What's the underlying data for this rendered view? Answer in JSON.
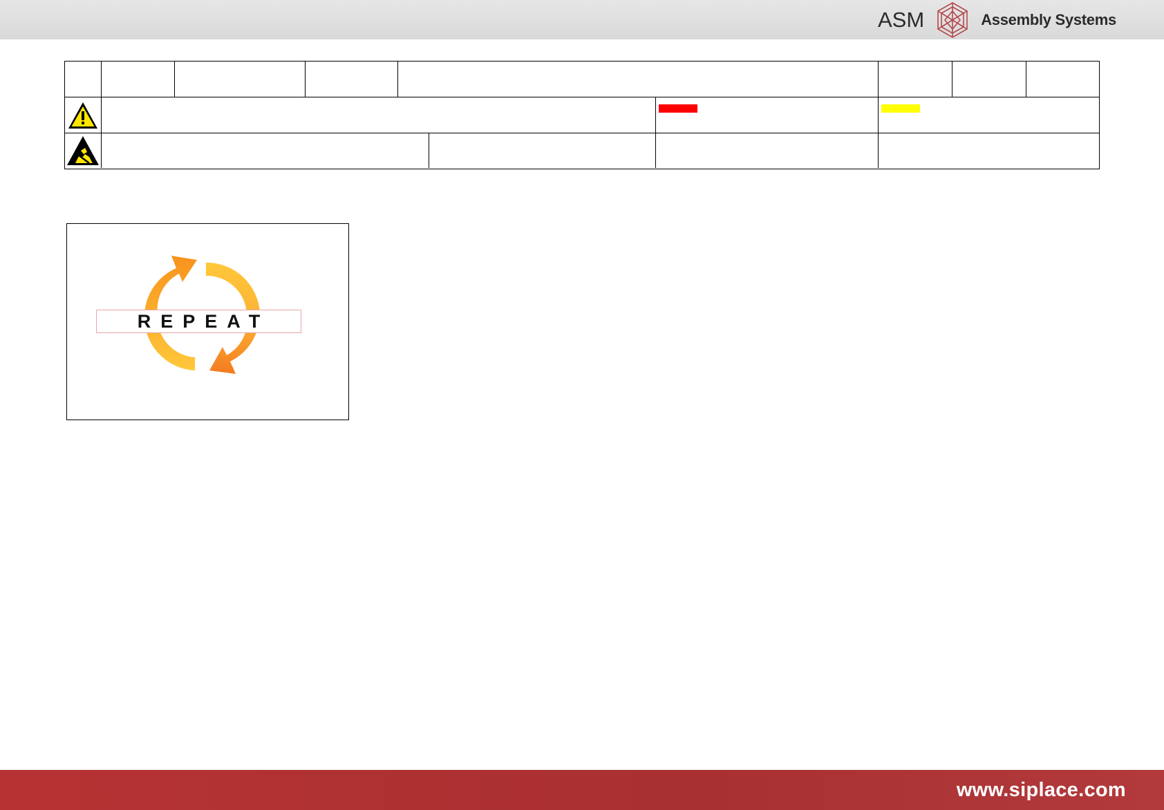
{
  "header": {
    "brand_name": "ASM",
    "brand_tagline": "Assembly Systems",
    "logo_icon": "asm-crystal-logo-icon"
  },
  "table": {
    "row1_cells": [
      "",
      "",
      "",
      "",
      "",
      "",
      "",
      ""
    ],
    "row2": {
      "icon": "warning-triangle-icon",
      "danger_color": "#ff0000",
      "caution_color": "#ffff00"
    },
    "row3": {
      "icon": "esd-warning-icon"
    }
  },
  "figure": {
    "label": "REPEAT",
    "icon": "repeat-cycle-arrows-icon",
    "arrow_colors": [
      "#f7941d",
      "#ffc20e"
    ]
  },
  "footer": {
    "url": "www.siplace.com",
    "color": "#ad3133"
  }
}
